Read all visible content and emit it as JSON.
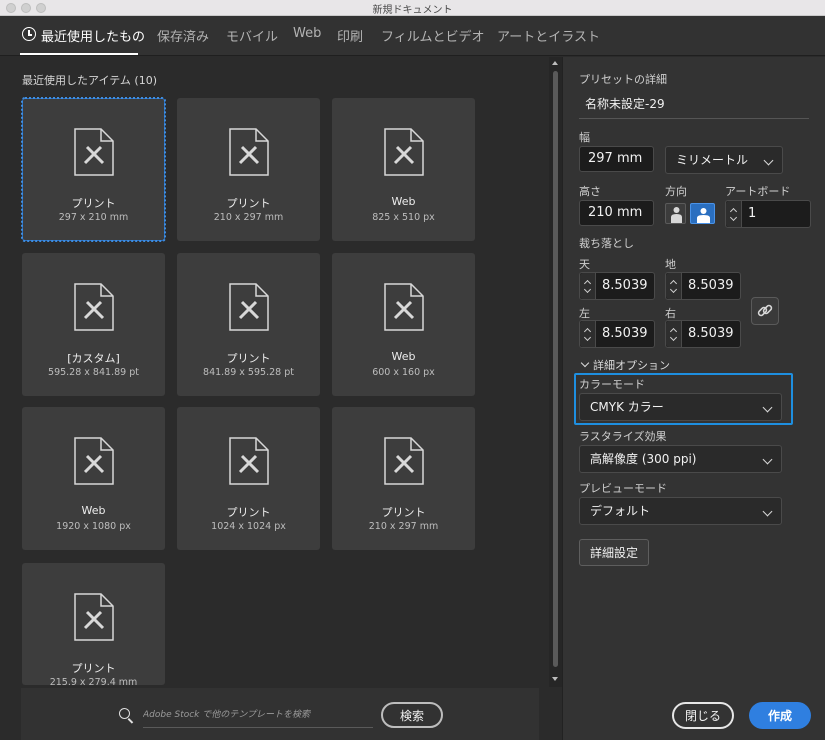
{
  "window": {
    "title": "新規ドキュメント"
  },
  "tabs": [
    {
      "label": "最近使用したもの",
      "active": true
    },
    {
      "label": "保存済み"
    },
    {
      "label": "モバイル"
    },
    {
      "label": "Web"
    },
    {
      "label": "印刷"
    },
    {
      "label": "フィルムとビデオ"
    },
    {
      "label": "アートとイラスト"
    }
  ],
  "recent": {
    "title": "最近使用したアイテム",
    "count": "(10)",
    "items": [
      {
        "name": "プリント",
        "size": "297 x 210 mm",
        "selected": true
      },
      {
        "name": "プリント",
        "size": "210 x 297 mm"
      },
      {
        "name": "Web",
        "size": "825 x 510 px"
      },
      {
        "name": "[カスタム]",
        "size": "595.28 x 841.89 pt"
      },
      {
        "name": "プリント",
        "size": "841.89 x 595.28 pt"
      },
      {
        "name": "Web",
        "size": "600 x 160 px"
      },
      {
        "name": "Web",
        "size": "1920 x 1080 px"
      },
      {
        "name": "プリント",
        "size": "1024 x 1024 px"
      },
      {
        "name": "プリント",
        "size": "210 x 297 mm"
      },
      {
        "name": "プリント",
        "size": "215.9 x 279.4 mm"
      }
    ]
  },
  "search": {
    "placeholder": "Adobe Stock で他のテンプレートを検索",
    "button": "検索"
  },
  "preset": {
    "header": "プリセットの詳細",
    "name": "名称未設定-29",
    "width_label": "幅",
    "width_value": "297 mm",
    "unit": "ミリメートル",
    "height_label": "高さ",
    "height_value": "210 mm",
    "orientation_label": "方向",
    "artboard_label": "アートボード",
    "artboard_value": "1",
    "bleed_label": "裁ち落とし",
    "bleed_top_label": "天",
    "bleed_top": "8.5039",
    "bleed_bottom_label": "地",
    "bleed_bottom": "8.5039",
    "bleed_left_label": "左",
    "bleed_left": "8.5039",
    "bleed_right_label": "右",
    "bleed_right": "8.5039",
    "advanced_label": "詳細オプション",
    "color_mode_label": "カラーモード",
    "color_mode_value": "CMYK カラー",
    "raster_label": "ラスタライズ効果",
    "raster_value": "高解像度 (300 ppi)",
    "preview_label": "プレビューモード",
    "preview_value": "デフォルト",
    "more_settings": "詳細設定",
    "close": "閉じる",
    "create": "作成"
  },
  "colors": {
    "accent": "#2f7fe0",
    "focus": "#1e8fe0",
    "panel": "#333333",
    "background": "#2b2b2b"
  }
}
